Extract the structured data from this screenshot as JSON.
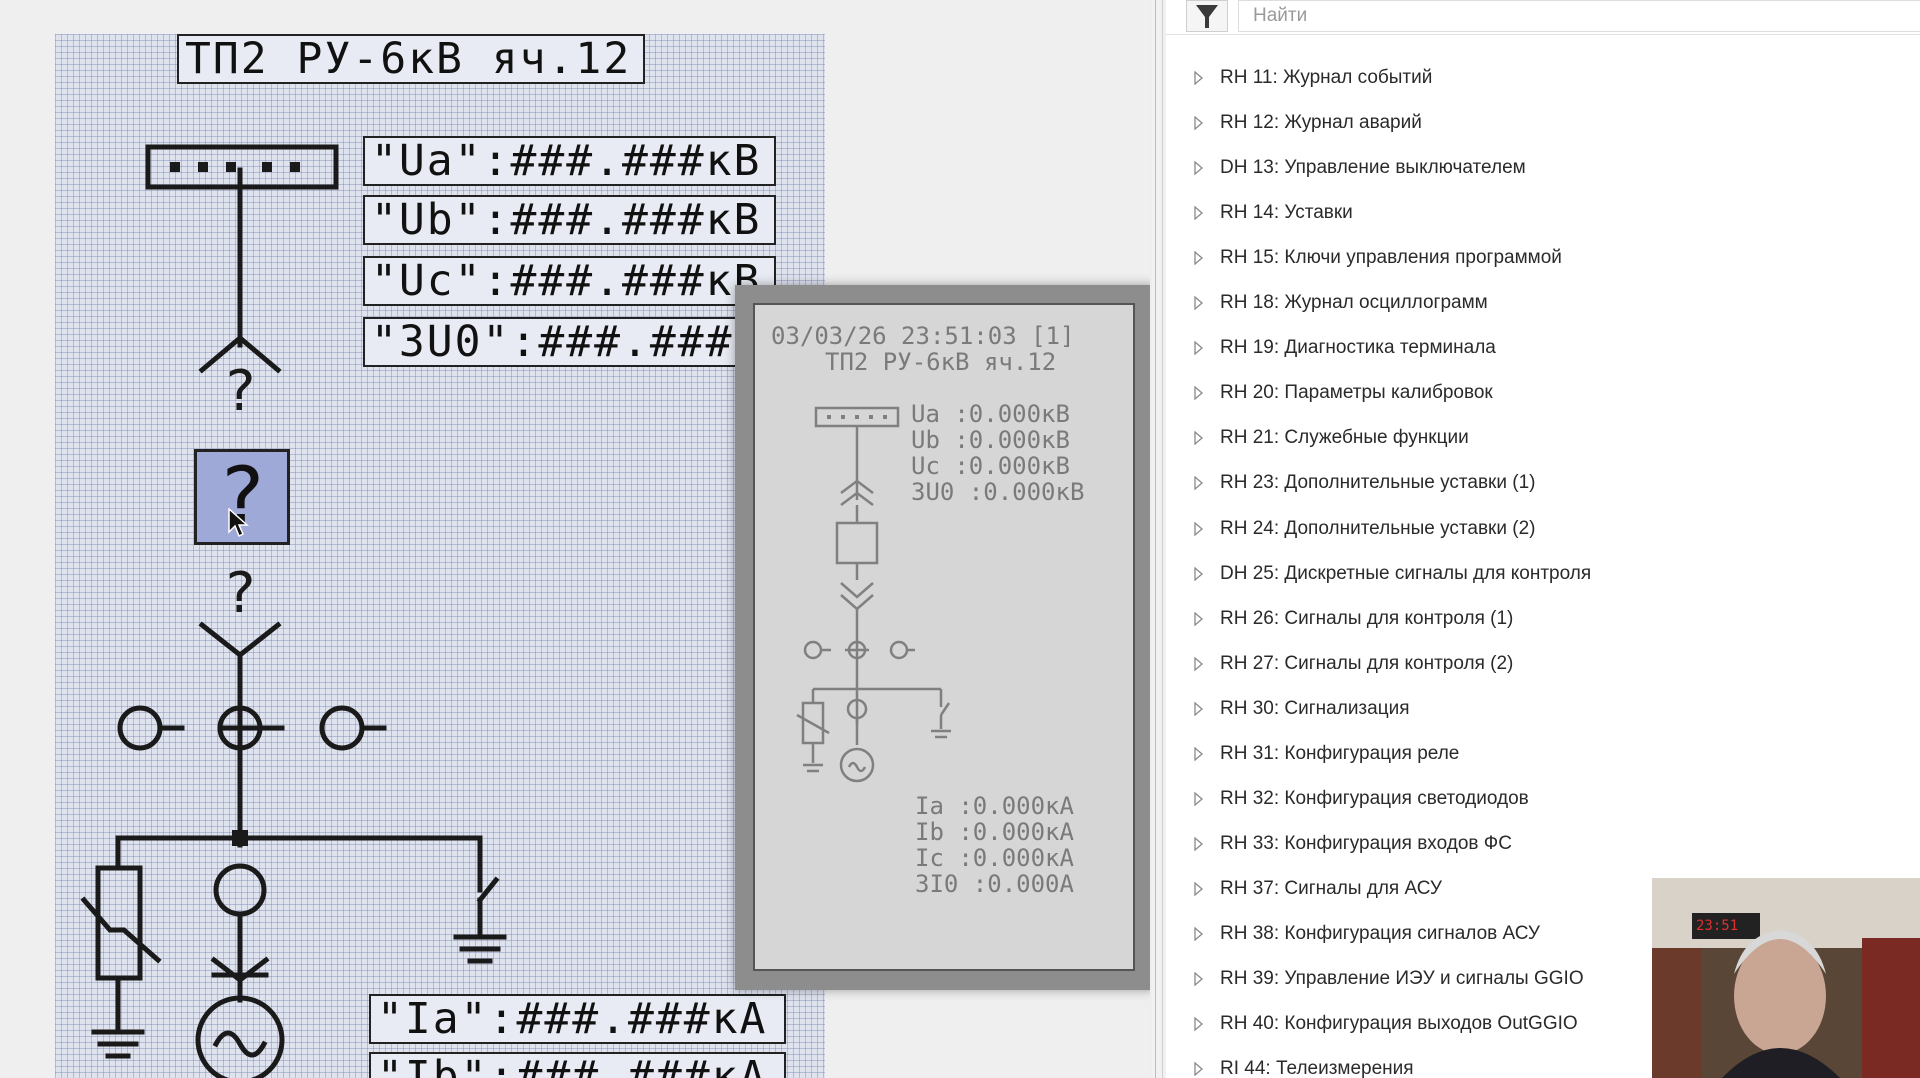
{
  "editor": {
    "title": "ТП2 РУ-6кВ яч.12",
    "ua": "\"Ua\":###.###кВ",
    "ub": "\"Ub\":###.###кВ",
    "uc": "\"Uc\":###.###кВ",
    "u0": "\"3U0\":###.###",
    "ia": "\"Ia\":###.###кА",
    "ib": "\"Ib\":###.###кА",
    "unknown_state": "?"
  },
  "device": {
    "datetime": "03/03/26 23:51:03 [1]",
    "title": "ТП2 РУ-6кВ яч.12",
    "ua": "Ua :0.000кВ",
    "ub": "Ub :0.000кВ",
    "uc": "Uc :0.000кВ",
    "u0": "3U0 :0.000кВ",
    "ia": "Ia :0.000кА",
    "ib": "Ib :0.000кА",
    "ic": "Ic :0.000кА",
    "i0": "3I0 :0.000А"
  },
  "search": {
    "placeholder": "Найти",
    "value": ""
  },
  "tree": {
    "items": [
      {
        "label": "RH 11: Журнал событий"
      },
      {
        "label": "RH 12: Журнал аварий"
      },
      {
        "label": "DH 13: Управление выключателем"
      },
      {
        "label": "RH 14: Уставки"
      },
      {
        "label": "RH 15: Ключи управления программой"
      },
      {
        "label": "RH 18: Журнал осциллограмм"
      },
      {
        "label": "RH 19: Диагностика терминала"
      },
      {
        "label": "RH 20: Параметры калибровок"
      },
      {
        "label": "RH 21: Служебные функции"
      },
      {
        "label": "RH 23: Дополнительные уставки (1)"
      },
      {
        "label": "RH 24: Дополнительные уставки (2)"
      },
      {
        "label": "DH 25: Дискретные сигналы для контроля"
      },
      {
        "label": "RH 26: Сигналы для контроля (1)"
      },
      {
        "label": "RH 27: Сигналы для контроля (2)"
      },
      {
        "label": "RH 30: Сигнализация"
      },
      {
        "label": "RH 31: Конфигурация реле"
      },
      {
        "label": "RH 32: Конфигурация светодиодов"
      },
      {
        "label": "RH 33: Конфигурация входов ФС"
      },
      {
        "label": "RH 37: Сигналы для АСУ"
      },
      {
        "label": "RH 38: Конфигурация сигналов АСУ"
      },
      {
        "label": "RH 39: Управление ИЭУ и сигналы GGIO"
      },
      {
        "label": "RH 40: Конфигурация выходов OutGGIO"
      },
      {
        "label": "RI 44: Телеизмерения"
      }
    ]
  },
  "webcam": {
    "clock": "23:51"
  },
  "colors": {
    "grid_bg": "#dfe3ee",
    "selection": "#9fa9d8",
    "device_lcd": "#d6d6d6",
    "tree_text": "#2a2a2a"
  }
}
